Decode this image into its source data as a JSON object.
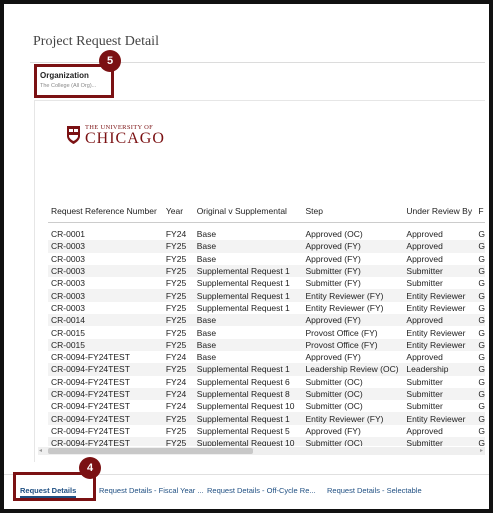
{
  "page": {
    "title": "Project Request Detail"
  },
  "filter": {
    "label": "Organization",
    "value": "The College (All Org)..."
  },
  "callouts": {
    "filter_badge": "5",
    "tab_badge": "4"
  },
  "logo": {
    "small": "THE UNIVERSITY OF",
    "big": "CHICAGO"
  },
  "table": {
    "columns": [
      "Request Reference Number",
      "Year",
      "Original v Supplemental",
      "Step",
      "Under Review By",
      "F"
    ],
    "rows": [
      [
        "CR-0001",
        "FY24",
        "Base",
        "Approved  (OC)",
        "Approved",
        "G"
      ],
      [
        "CR-0003",
        "FY25",
        "Base",
        "Approved (FY)",
        "Approved",
        "G"
      ],
      [
        "CR-0003",
        "FY25",
        "Base",
        "Approved (FY)",
        "Approved",
        "G"
      ],
      [
        "CR-0003",
        "FY25",
        "Supplemental Request 1",
        "Submitter (FY)",
        "Submitter",
        "G"
      ],
      [
        "CR-0003",
        "FY25",
        "Supplemental Request 1",
        "Submitter (FY)",
        "Submitter",
        "G"
      ],
      [
        "CR-0003",
        "FY25",
        "Supplemental Request 1",
        "Entity Reviewer (FY)",
        "Entity Reviewer",
        "G"
      ],
      [
        "CR-0003",
        "FY25",
        "Supplemental Request 1",
        "Entity Reviewer (FY)",
        "Entity Reviewer",
        "G"
      ],
      [
        "CR-0014",
        "FY25",
        "Base",
        "Approved (FY)",
        "Approved",
        "G"
      ],
      [
        "CR-0015",
        "FY25",
        "Base",
        "Provost Office (FY)",
        "Entity Reviewer",
        "G"
      ],
      [
        "CR-0015",
        "FY25",
        "Base",
        "Provost Office (FY)",
        "Entity Reviewer",
        "G"
      ],
      [
        "CR-0094-FY24TEST",
        "FY24",
        "Base",
        "Approved (FY)",
        "Approved",
        "G"
      ],
      [
        "CR-0094-FY24TEST",
        "FY25",
        "Supplemental Request 1",
        "Leadership Review (OC)",
        "Leadership",
        "G"
      ],
      [
        "CR-0094-FY24TEST",
        "FY24",
        "Supplemental Request 6",
        "Submitter (OC)",
        "Submitter",
        "G"
      ],
      [
        "CR-0094-FY24TEST",
        "FY24",
        "Supplemental Request 8",
        "Submitter (OC)",
        "Submitter",
        "G"
      ],
      [
        "CR-0094-FY24TEST",
        "FY24",
        "Supplemental Request 10",
        "Submitter (OC)",
        "Submitter",
        "G"
      ],
      [
        "CR-0094-FY24TEST",
        "FY25",
        "Supplemental Request 1",
        "Entity Reviewer (FY)",
        "Entity Reviewer",
        "G"
      ],
      [
        "CR-0094-FY24TEST",
        "FY25",
        "Supplemental Request 5",
        "Approved (FY)",
        "Approved",
        "G"
      ],
      [
        "CR-0094-FY24TEST",
        "FY25",
        "Supplemental Request 10",
        "Submitter (OC)",
        "Submitter",
        "G"
      ]
    ]
  },
  "tabs": [
    {
      "label": "Request Details",
      "active": true
    },
    {
      "label": "Request Details - Fiscal Year ...",
      "active": false
    },
    {
      "label": "Request Details - Off-Cycle Re...",
      "active": false
    },
    {
      "label": "Request Details - Selectable",
      "active": false
    }
  ],
  "colors": {
    "brand": "#7b1113",
    "link": "#1f4f82",
    "callout": "#7b1113"
  },
  "icons": {
    "logo": "university-shield-icon"
  }
}
